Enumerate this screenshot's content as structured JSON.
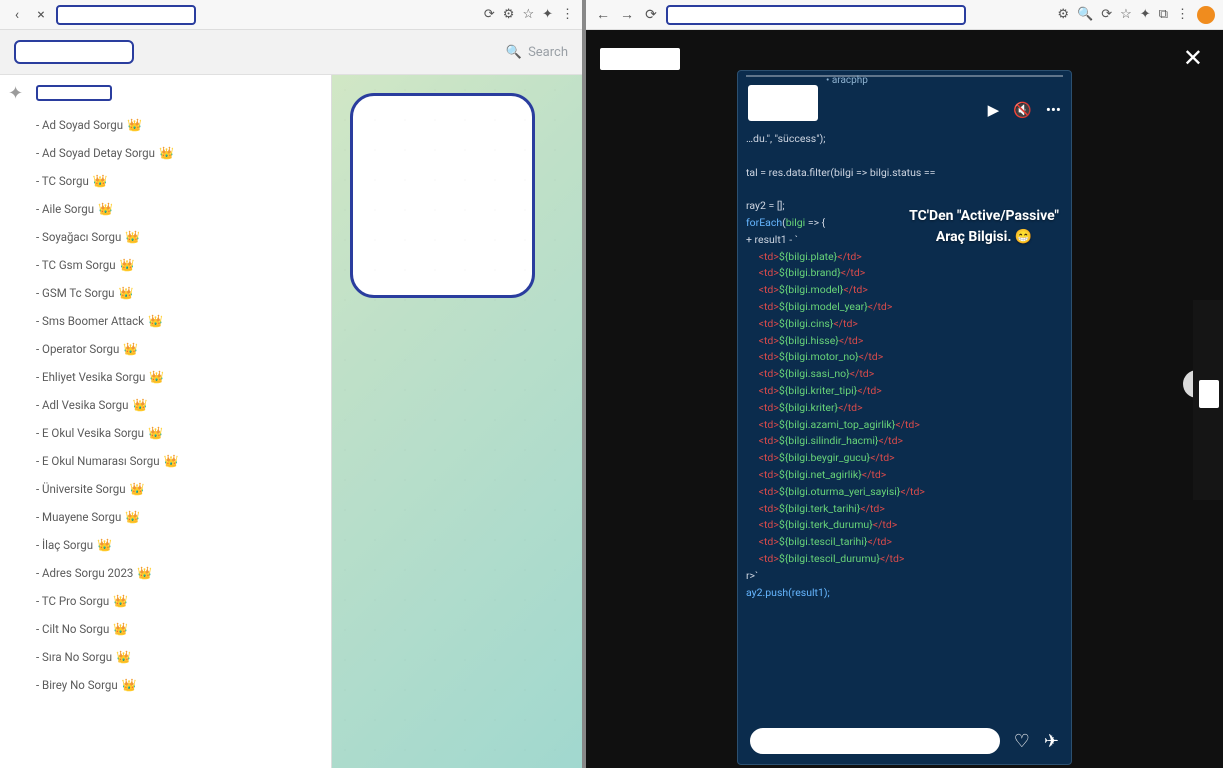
{
  "left": {
    "browser_bar": {
      "nav_icons": [
        "‹",
        "×"
      ],
      "ext_icons": [
        "⟳",
        "⚙",
        "☆",
        "✦",
        "⋮"
      ]
    },
    "header": {
      "search_placeholder": "Search"
    },
    "crown": "👑",
    "menu_items": [
      "- Ad Soyad Sorgu",
      "- Ad Soyad Detay Sorgu",
      "- TC Sorgu",
      "- Aile Sorgu",
      "- Soyağacı Sorgu",
      "- TC Gsm Sorgu",
      "- GSM Tc Sorgu",
      "- Sms Boomer Attack",
      "- Operator Sorgu",
      "- Ehliyet Vesika Sorgu",
      "- Adl Vesika Sorgu",
      "- E Okul Vesika Sorgu",
      "- E Okul Numarası Sorgu",
      "- Üniversite Sorgu",
      "- Muayene Sorgu",
      "- İlaç Sorgu",
      "- Adres Sorgu 2023",
      "- TC Pro Sorgu",
      "- Cilt No Sorgu",
      "- Sıra No Sorgu",
      "- Birey No Sorgu"
    ]
  },
  "right": {
    "browser_bar": {
      "nav_icons": [
        "←",
        "→",
        "⟳"
      ],
      "ext_icons": [
        "⚙",
        "🔍",
        "⟳",
        "☆",
        "✦",
        "⧉",
        "⋮"
      ]
    },
    "overlay_line1": "TC'Den \"Active/Passive\"",
    "overlay_line2": "Araç Bilgisi. 😁",
    "code": {
      "head": "…du.\", \"süccess\");",
      "filter": "tal = res.data.filter(bilgi => bilgi.status ==",
      "arr": "ray2 = [];",
      "foreach": "forEach(bilgi => {",
      "resline": "+ result1 - `<tr>",
      "rows": [
        "${bilgi.plate}",
        "${bilgi.brand}",
        "${bilgi.model}",
        "${bilgi.model_year}",
        "${bilgi.cins}",
        "${bilgi.hisse}",
        "${bilgi.motor_no}",
        "${bilgi.sasi_no}",
        "${bilgi.kriter_tipi}",
        "${bilgi.kriter}",
        "${bilgi.azami_top_agirlik}",
        "${bilgi.silindir_hacmi}",
        "${bilgi.beygir_gucu}",
        "${bilgi.net_agirlik}",
        "${bilgi.oturma_yeri_sayisi}",
        "${bilgi.terk_tarihi}",
        "${bilgi.terk_durumu}",
        "${bilgi.tescil_tarihi}",
        "${bilgi.tescil_durumu}"
      ],
      "closerow": "r>`",
      "push": "ay2.push(result1);"
    },
    "icons": {
      "play": "▶",
      "mute": "🔇",
      "more": "•••",
      "close": "✕",
      "next": "›",
      "heart": "♡",
      "send": "✈"
    },
    "meta": "• aracphp"
  }
}
